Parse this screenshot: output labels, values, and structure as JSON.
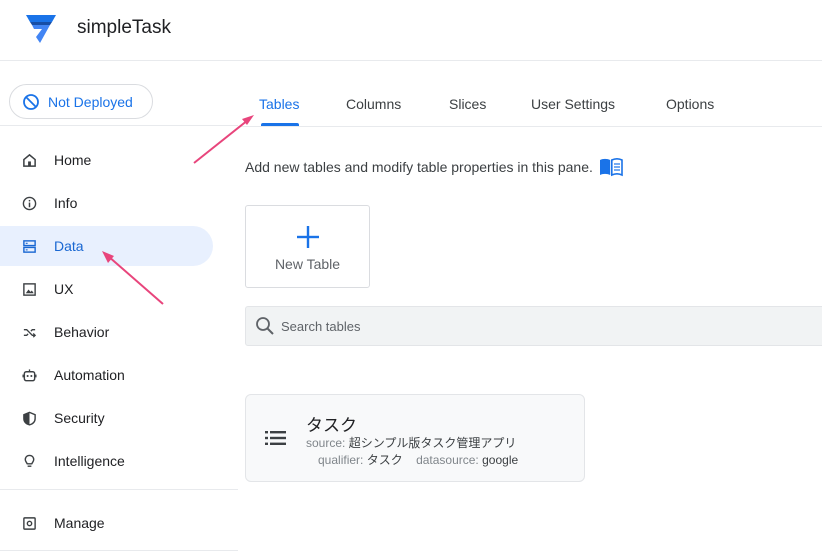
{
  "app": {
    "title": "simpleTask"
  },
  "deploy_status": {
    "label": "Not Deployed"
  },
  "sidebar": {
    "items": [
      {
        "label": "Home",
        "icon": "home-icon"
      },
      {
        "label": "Info",
        "icon": "info-icon"
      },
      {
        "label": "Data",
        "icon": "data-icon",
        "active": true
      },
      {
        "label": "UX",
        "icon": "image-icon"
      },
      {
        "label": "Behavior",
        "icon": "shuffle-icon"
      },
      {
        "label": "Automation",
        "icon": "robot-icon"
      },
      {
        "label": "Security",
        "icon": "shield-icon"
      },
      {
        "label": "Intelligence",
        "icon": "lightbulb-icon"
      }
    ],
    "manage": {
      "label": "Manage",
      "icon": "gear-box-icon"
    }
  },
  "tabs": [
    {
      "label": "Tables",
      "active": true
    },
    {
      "label": "Columns"
    },
    {
      "label": "Slices"
    },
    {
      "label": "User Settings"
    },
    {
      "label": "Options"
    }
  ],
  "description": "Add new tables and modify table properties in this pane.",
  "new_table": {
    "label": "New Table"
  },
  "search": {
    "placeholder": "Search tables",
    "value": ""
  },
  "tables": [
    {
      "name": "タスク",
      "source_key": "source:",
      "source": "超シンプル版タスク管理アプリ",
      "qualifier_key": "qualifier:",
      "qualifier": "タスク",
      "datasource_key": "datasource:",
      "datasource": "google"
    }
  ],
  "colors": {
    "accent": "#1a73e8",
    "active_bg": "#e8f0fe",
    "annotation_arrow": "#e8457c",
    "logo": "#1a73e8"
  }
}
